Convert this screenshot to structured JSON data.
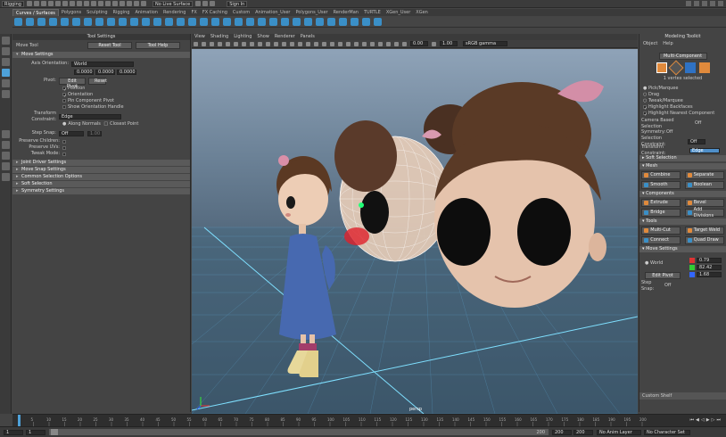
{
  "menubar": {
    "workspace": "Rigging",
    "live_surface": "No Live Surface",
    "login": "Sign In"
  },
  "shelf_tabs": [
    "Curves / Surfaces",
    "Polygons",
    "Sculpting",
    "Rigging",
    "Animation",
    "Rendering",
    "FX",
    "FX Caching",
    "Custom",
    "Animation_User",
    "Polygons_User",
    "RenderMan",
    "TURTLE",
    "XGen_User",
    "XGen"
  ],
  "tool_settings": {
    "header": "Tool Settings",
    "tool_name": "Move Tool",
    "reset_button": "Reset Tool",
    "help_button": "Tool Help",
    "move_settings": "Move Settings",
    "axis_orientation_label": "Axis Orientation:",
    "axis_orientation_value": "World",
    "axis_values": [
      "0.0000",
      "0.0000",
      "0.0000"
    ],
    "pivot_label": "Pivot:",
    "edit_pivot": "Edit Pivot",
    "reset": "Reset",
    "pivot_checks": [
      "Position",
      "Orientation",
      "Pin Component Pivot",
      "Show Orientation Handle"
    ],
    "transform_constraint_label": "Transform Constraint:",
    "transform_constraint_value": "Edge",
    "along_normals": "Along Normals",
    "closest_point": "Closest Point",
    "step_snap_label": "Step Snap:",
    "step_snap_value": "Off",
    "step_snap_num": "1.00",
    "preserve_children": "Preserve Children:",
    "preserve_uvs": "Preserve UVs:",
    "tweak_mode": "Tweak Mode:",
    "collapsed_sections": [
      "Joint Driver Settings",
      "Move Snap Settings",
      "Common Selection Options",
      "Soft Selection",
      "Symmetry Settings"
    ]
  },
  "viewport": {
    "menu": [
      "View",
      "Shading",
      "Lighting",
      "Show",
      "Renderer",
      "Panels"
    ],
    "field_a": "0.00",
    "field_b": "1.00",
    "color_space": "sRGB gamma",
    "camera_label": "persp"
  },
  "modeling_toolkit": {
    "title": "Modeling Toolkit",
    "menu": [
      "Object",
      "Help"
    ],
    "multi_component": "Multi-Component",
    "selection_info": "1 vertex selected",
    "options": [
      "Pick/Marquee",
      "Drag",
      "Tweak/Marquee"
    ],
    "checks": [
      "Highlight Backfaces",
      "Highlight Nearest Component"
    ],
    "camera_based_selection": "Camera Based Selection",
    "camera_based_value": "Off",
    "symmetry_label": "Symmetry:",
    "symmetry_value": "Off",
    "selection_constraint_label": "Selection Constraint:",
    "selection_constraint_value": "Off",
    "transform_constraint_label": "Transform Constraint:",
    "transform_constraint_value": "Edge",
    "soft_selection": "Soft Selection",
    "mesh_section": "Mesh",
    "mesh_buttons": [
      "Combine",
      "Separate",
      "Smooth",
      "Boolean"
    ],
    "components_section": "Components",
    "components_buttons": [
      "Extrude",
      "Bevel",
      "Bridge",
      "Add Divisions"
    ],
    "tools_section": "Tools",
    "tools_buttons": [
      "Multi-Cut",
      "Target Weld",
      "Connect",
      "Quad Draw"
    ],
    "move_settings": "Move Settings",
    "world_label": "World",
    "xyz": [
      "0.79",
      "82.42",
      "1.68"
    ],
    "edit_pivot": "Edit Pivot",
    "step_snap_label": "Step Snap:",
    "step_snap_value": "Off",
    "custom_shelf": "Custom Shelf"
  },
  "timeline": {
    "current_frame": "1",
    "start": "1",
    "range_start": "1",
    "range_end": "200",
    "end": "200",
    "end2": "200",
    "anim_layer": "No Anim Layer",
    "character_set": "No Character Set",
    "ticks": [
      "5",
      "10",
      "15",
      "20",
      "25",
      "30",
      "35",
      "40",
      "45",
      "50",
      "55",
      "60",
      "65",
      "70",
      "75",
      "80",
      "85",
      "90",
      "95",
      "100",
      "105",
      "110",
      "115",
      "120",
      "125",
      "130",
      "135",
      "140",
      "145",
      "150",
      "155",
      "160",
      "165",
      "170",
      "175",
      "180",
      "185",
      "190",
      "195",
      "200"
    ],
    "playhead": "1"
  },
  "colors": {
    "accent": "#4ea1d9",
    "highlight_field": "#4f8fc9"
  }
}
